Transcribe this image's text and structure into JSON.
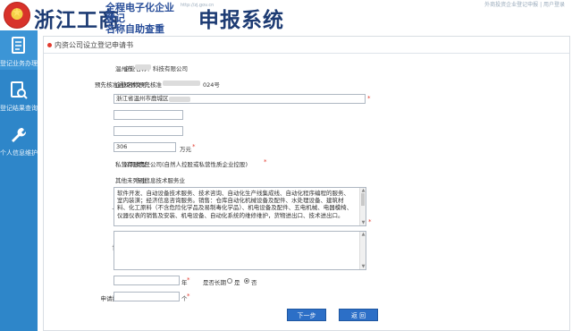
{
  "header": {
    "brand": "浙江工商",
    "subtitle_line1": "全程电子化企业登记",
    "subtitle_line2": "名称自助查重",
    "url_text": "http://zj.gov.cn",
    "main_title": "申报系统",
    "top_links": "外商投资企业登记申报 | 用户登录"
  },
  "sidebar": {
    "items": [
      {
        "label": "登记业务办理",
        "icon": "document-icon"
      },
      {
        "label": "登记结果查询",
        "icon": "search-document-icon"
      },
      {
        "label": "个人信息维护",
        "icon": "wrench-icon"
      }
    ]
  },
  "panel": {
    "title": "内资公司设立登记申请书"
  },
  "form": {
    "company_name_label": "企业名称：",
    "company_name_value_prefix": "温州市",
    "company_name_value_suffix": "科技有限公司",
    "notice_label": "预先核准通知书文号：",
    "notice_value_prefix": "企业名称预先核准",
    "notice_value_suffix": "024号",
    "address_label": "住所所在地：",
    "address_value": "浙江省温州市鹿城区",
    "phone_label": "联系电话：",
    "phone_value": "",
    "postcode_label": "邮政编码：",
    "postcode_value": "",
    "capital_label": "注册资本：",
    "capital_value": "306",
    "capital_unit": "万元",
    "company_type_label": "公司类型：",
    "company_type_value": "私营有限责任公司(自然人控股或私营性质企业控股)",
    "industry_label": "行业：",
    "industry_value": "其他未列明信息技术服务业",
    "general_scope_label": "一般经营项目：",
    "general_scope_value": "软件开发、自动设备技术服务、技术咨询、自动化生产线集成线、自动化程序编程的服务、室内装潢；经济信息咨询服务。销售：仓库自动化机械设备及配件、水处理设备、建筑材料、化工原料（不含危险化学品及易制毒化学品）、机电设备及配件、五电机械、电器模椅、仪器仪表的销售及安装、机电设备、自动化系统的维修维护，货物进出口、技术进出口。",
    "licensed_scope_label": "许可经营项目：",
    "licensed_scope_value": "",
    "term_label": "经营期限：",
    "term_value": "",
    "term_unit": "年",
    "longterm_label": "是否长期",
    "yes_label": "是",
    "no_label": "否",
    "copies_label": "申请执照副本数量：",
    "copies_value": "",
    "copies_unit": "个"
  },
  "buttons": {
    "next": "下一步",
    "back": "返 回"
  },
  "colors": {
    "sidebar": "#2e86c9",
    "accent": "#2c6fc7",
    "required": "#e23b2f",
    "brand": "#1d3b73"
  }
}
